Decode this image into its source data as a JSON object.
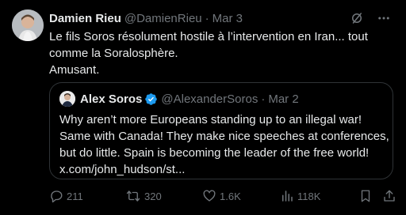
{
  "author": {
    "name": "Damien Rieu",
    "handle": "@DamienRieu",
    "date": "Mar 3"
  },
  "tweet": {
    "lines": [
      "Le fils Soros résolument hostile à l’intervention en Iran... tout",
      "comme la Soralosphère.",
      "Amusant."
    ]
  },
  "quoted": {
    "name": "Alex Soros",
    "handle": "@AlexanderSoros",
    "date": "Mar 2",
    "lines": [
      "Why aren’t more Europeans standing up to an illegal war!",
      "Same with Canada! They make nice speeches at conferences,",
      "but do little. Spain is becoming the leader of the free world!",
      "x.com/john_hudson/st..."
    ]
  },
  "actions": {
    "replies": "211",
    "reposts": "320",
    "likes": "1.6K",
    "views": "118K"
  },
  "icons": {
    "top": [
      "grok-icon",
      "more-icon"
    ],
    "actions": [
      "reply-icon",
      "repost-icon",
      "like-icon",
      "views-icon",
      "bookmark-icon",
      "share-icon"
    ]
  },
  "colors": {
    "background": "#000000",
    "text": "#e7e9ea",
    "muted": "#71767b",
    "border": "#2f3336",
    "verified": "#1d9bf0"
  }
}
